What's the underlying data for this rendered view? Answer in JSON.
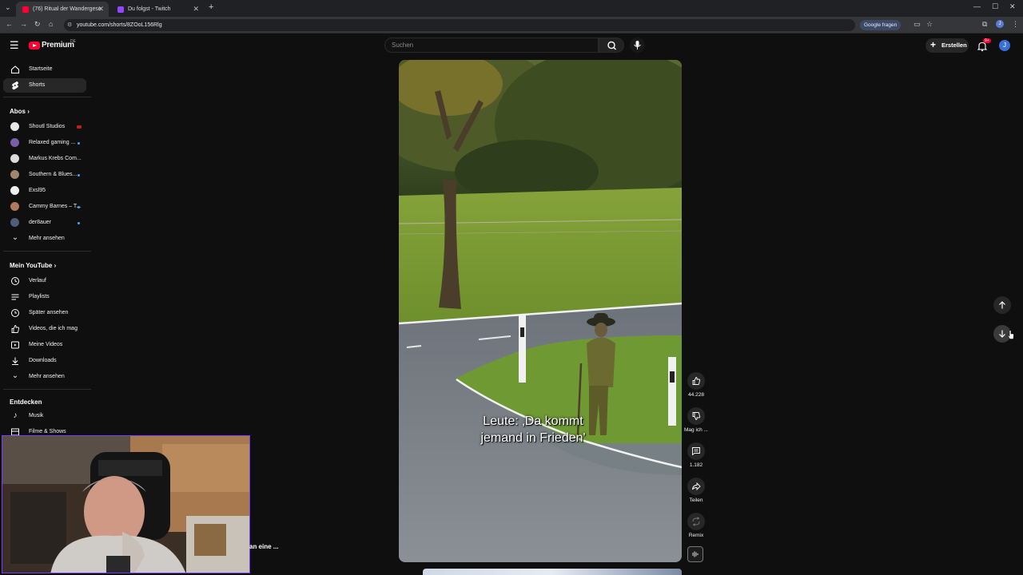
{
  "browser": {
    "tabs": [
      {
        "title": "(76) Ritual der Wandergese",
        "active": true
      },
      {
        "title": "Du folgst - Twitch",
        "active": false
      }
    ],
    "url": "youtube.com/shorts/8ZOoL156Rlg",
    "google_button": "Google fragen"
  },
  "header": {
    "logo_text": "Premium",
    "logo_sup": "DE",
    "search_placeholder": "Suchen",
    "create_label": "Erstellen",
    "notification_count": "9+"
  },
  "sidebar": {
    "main": [
      {
        "label": "Startseite"
      },
      {
        "label": "Shorts"
      }
    ],
    "subs_title": "Abos",
    "subs": [
      {
        "label": "Shoutl Studios",
        "color": "#e8e8e8",
        "badge": "live"
      },
      {
        "label": "Relaxed gaming ...",
        "color": "#7b5ea7",
        "badge": "dot"
      },
      {
        "label": "Markus Krebs Com...",
        "color": "#dcdcdc",
        "badge": ""
      },
      {
        "label": "Southern & Blues...",
        "color": "#a0876b",
        "badge": "dot"
      },
      {
        "label": "Exsl95",
        "color": "#f0f0f0",
        "badge": ""
      },
      {
        "label": "Cammy Barnes – T...",
        "color": "#b0785c",
        "badge": "dot"
      },
      {
        "label": "der8auer",
        "color": "#4f5d7a",
        "badge": "dot"
      }
    ],
    "subs_more": "Mehr ansehen",
    "you_title": "Mein YouTube",
    "you": [
      {
        "label": "Verlauf"
      },
      {
        "label": "Playlists"
      },
      {
        "label": "Später ansehen"
      },
      {
        "label": "Videos, die ich mag"
      },
      {
        "label": "Meine Videos"
      },
      {
        "label": "Downloads"
      },
      {
        "label": "Mehr ansehen"
      }
    ],
    "explore_title": "Entdecken",
    "explore": [
      {
        "label": "Musik"
      },
      {
        "label": "Filme & Shows"
      }
    ]
  },
  "video": {
    "caption_line1": "Leute: ‚Da kommt",
    "caption_line2": "jemand in Frieden'"
  },
  "actions": {
    "like_count": "44.228",
    "dislike_label": "Mag ich ...",
    "comments_count": "1.182",
    "share_label": "Teilen",
    "remix_label": "Remix"
  },
  "webcam": {
    "overlay_text": "an eine ..."
  },
  "colors": {
    "background": "#0f0f0f",
    "accent_red": "#ff0033",
    "webcam_border": "#7a3cff"
  }
}
